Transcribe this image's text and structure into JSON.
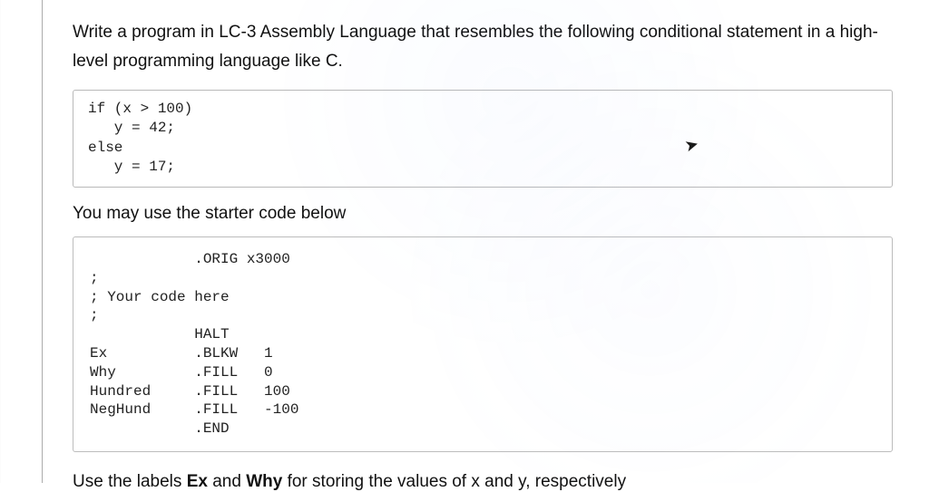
{
  "question": {
    "intro": "Write a program in LC-3 Assembly Language that resembles the following conditional statement in a high-level programming language like C.",
    "c_code": "if (x > 100)\n   y = 42;\nelse\n   y = 17;",
    "starter_prompt": "You may use the starter code below",
    "starter_code": "            .ORIG x3000\n;\n; Your code here\n;\n            HALT\nEx          .BLKW   1\nWhy         .FILL   0\nHundred     .FILL   100\nNegHund     .FILL   -100\n            .END",
    "final_note_prefix": "Use the labels ",
    "label_ex": "Ex",
    "middle": " and ",
    "label_why": "Why",
    "final_note_suffix": " for storing the values of x and y, respectively"
  },
  "cursor_glyph": "↖"
}
